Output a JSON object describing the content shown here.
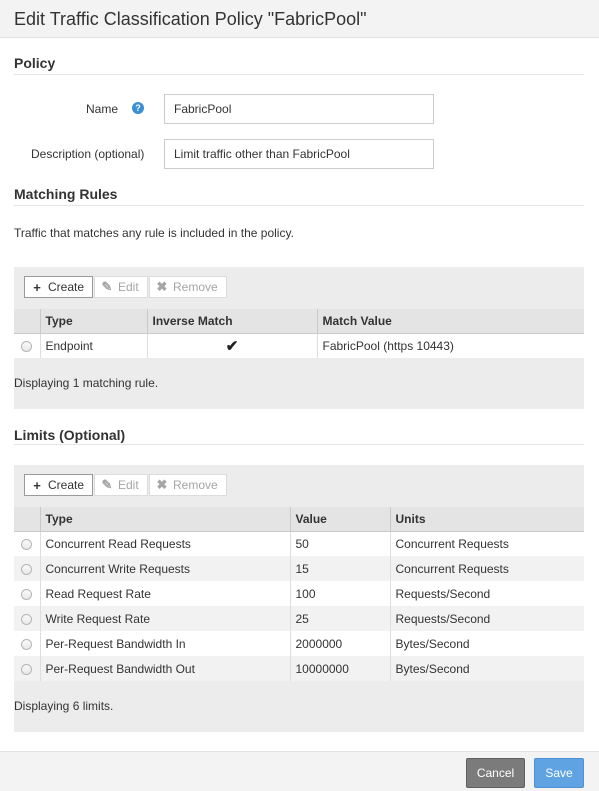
{
  "dialog": {
    "title": "Edit Traffic Classification Policy \"FabricPool\""
  },
  "policy": {
    "section_title": "Policy",
    "name_label": "Name",
    "help_icon": "?",
    "name_value": "FabricPool",
    "description_label": "Description (optional)",
    "description_value": "Limit traffic other than FabricPool"
  },
  "matching_rules": {
    "section_title": "Matching Rules",
    "description": "Traffic that matches any rule is included in the policy.",
    "toolbar": {
      "create": "Create",
      "edit": "Edit",
      "remove": "Remove"
    },
    "columns": [
      "Type",
      "Inverse Match",
      "Match Value"
    ],
    "rows": [
      {
        "type": "Endpoint",
        "inverse_match": "✔",
        "match_value": "FabricPool (https 10443)"
      }
    ],
    "footer": "Displaying 1 matching rule."
  },
  "limits": {
    "section_title": "Limits (Optional)",
    "toolbar": {
      "create": "Create",
      "edit": "Edit",
      "remove": "Remove"
    },
    "columns": [
      "Type",
      "Value",
      "Units"
    ],
    "rows": [
      {
        "type": "Concurrent Read Requests",
        "value": "50",
        "units": "Concurrent Requests"
      },
      {
        "type": "Concurrent Write Requests",
        "value": "15",
        "units": "Concurrent Requests"
      },
      {
        "type": "Read Request Rate",
        "value": "100",
        "units": "Requests/Second"
      },
      {
        "type": "Write Request Rate",
        "value": "25",
        "units": "Requests/Second"
      },
      {
        "type": "Per-Request Bandwidth In",
        "value": "2000000",
        "units": "Bytes/Second"
      },
      {
        "type": "Per-Request Bandwidth Out",
        "value": "10000000",
        "units": "Bytes/Second"
      }
    ],
    "footer": "Displaying 6 limits."
  },
  "footer": {
    "cancel": "Cancel",
    "save": "Save"
  },
  "icons": {
    "create": "plus-icon",
    "edit": "pencil-icon",
    "remove": "x-icon",
    "help": "question-icon"
  },
  "colors": {
    "save_button": "#5fa3e3",
    "cancel_button": "#7b7b7b",
    "help_icon": "#3b8fd6"
  }
}
